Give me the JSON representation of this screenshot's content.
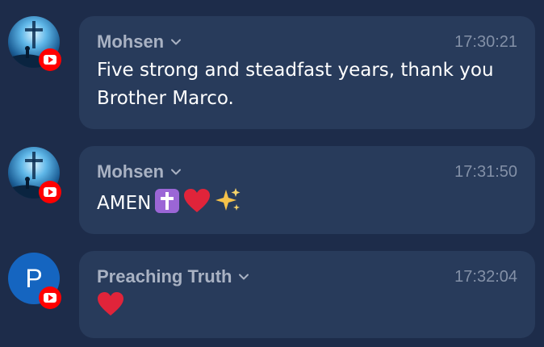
{
  "messages": [
    {
      "author": "Mohsen",
      "time": "17:30:21",
      "text": "Five strong and steadfast years, thank you Brother Marco.",
      "avatar": "cross-silhouette-avatar",
      "badge": "youtube-badge-icon"
    },
    {
      "author": "Mohsen",
      "time": "17:31:50",
      "text": "AMEN",
      "emojis": [
        "latin-cross-emoji",
        "red-heart-emoji",
        "sparkles-emoji"
      ],
      "avatar": "cross-silhouette-avatar",
      "badge": "youtube-badge-icon"
    },
    {
      "author": "Preaching Truth",
      "avatar_letter": "P",
      "time": "17:32:04",
      "emojis": [
        "red-heart-emoji"
      ],
      "badge": "youtube-badge-icon"
    }
  ],
  "colors": {
    "background": "#1d2c4a",
    "bubble": "#283b5b",
    "author": "#a9b2c3",
    "time": "#8390a7",
    "text": "#ffffff",
    "badge": "#ff0000",
    "letter_avatar": "#1565c0"
  }
}
